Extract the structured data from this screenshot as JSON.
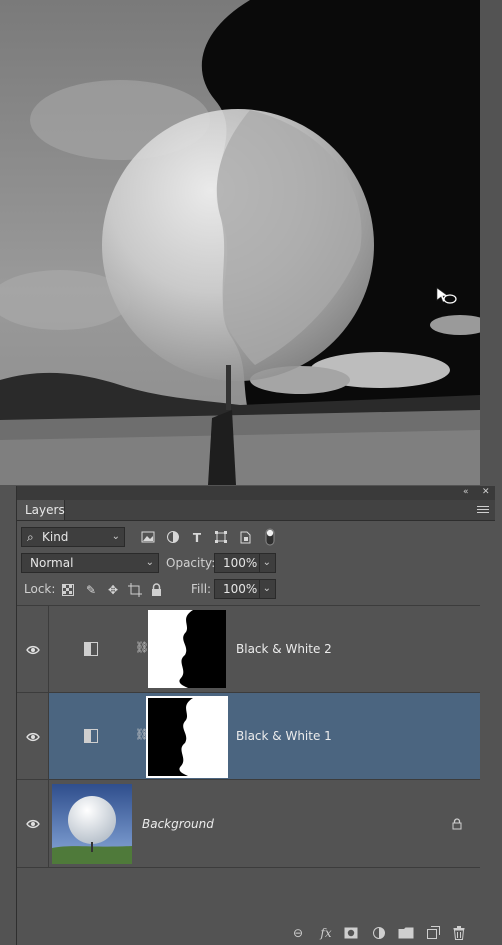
{
  "panel": {
    "tab_label": "Layers",
    "collapse_icon": "double-chevron-icon",
    "close_icon": "close-icon"
  },
  "filter": {
    "kind_label": "Kind",
    "icons": [
      "image-filter-icon",
      "adjustment-filter-icon",
      "type-filter-icon",
      "shape-filter-icon",
      "smart-object-filter-icon",
      "filter-toggle-icon"
    ]
  },
  "blend": {
    "mode": "Normal",
    "opacity_label": "Opacity:",
    "opacity_value": "100%",
    "lock_label": "Lock:",
    "fill_label": "Fill:",
    "fill_value": "100%"
  },
  "layers": [
    {
      "name": "Black & White 2",
      "selected": false,
      "type": "adjustment"
    },
    {
      "name": "Black & White 1",
      "selected": true,
      "type": "adjustment"
    },
    {
      "name": "Background",
      "selected": false,
      "type": "background",
      "locked": true
    }
  ],
  "colors": {
    "selected_row": "#4b6580",
    "panel_bg": "#535353"
  }
}
